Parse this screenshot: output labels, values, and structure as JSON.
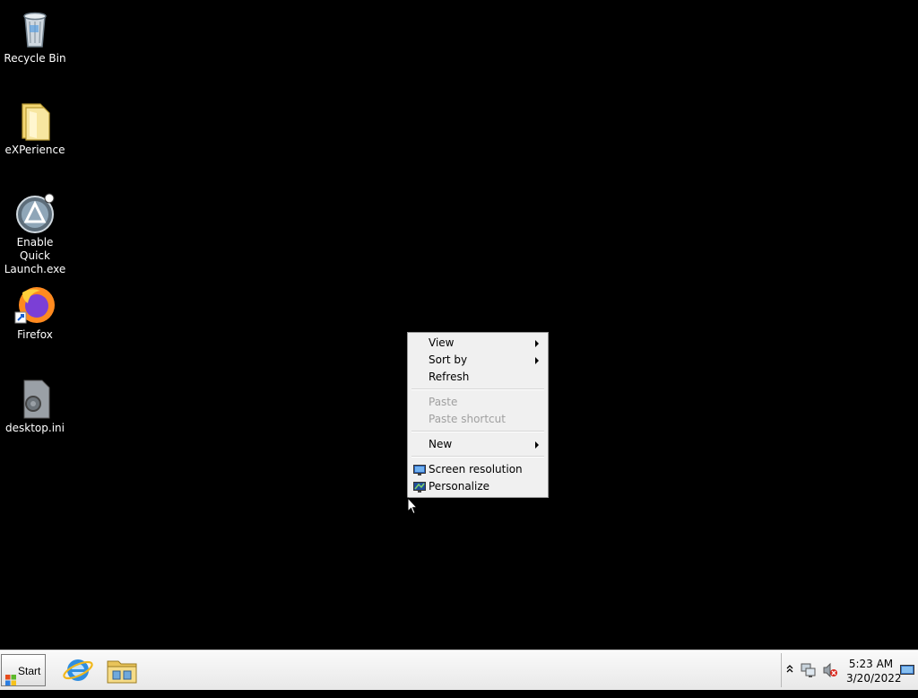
{
  "desktop": {
    "icons": [
      {
        "label": "Recycle Bin",
        "icon": "recycle-bin-icon"
      },
      {
        "label": "eXPerience",
        "icon": "folder-icon"
      },
      {
        "label": "Enable Quick Launch.exe",
        "icon": "app-exe-icon"
      },
      {
        "label": "Firefox",
        "icon": "firefox-icon"
      },
      {
        "label": "desktop.ini",
        "icon": "settings-file-icon"
      }
    ]
  },
  "context_menu": {
    "items": [
      {
        "label": "View",
        "enabled": true,
        "submenu": true
      },
      {
        "label": "Sort by",
        "enabled": true,
        "submenu": true
      },
      {
        "label": "Refresh",
        "enabled": true
      },
      {
        "label": "Paste",
        "enabled": false
      },
      {
        "label": "Paste shortcut",
        "enabled": false
      },
      {
        "label": "New",
        "enabled": true,
        "submenu": true
      },
      {
        "label": "Screen resolution",
        "enabled": true,
        "icon": "display-icon"
      },
      {
        "label": "Personalize",
        "enabled": true,
        "icon": "personalize-icon"
      }
    ]
  },
  "taskbar": {
    "start_label": "Start",
    "pinned": [
      {
        "icon": "internet-explorer-icon"
      },
      {
        "icon": "file-explorer-icon"
      }
    ],
    "clock": {
      "time": "5:23 AM",
      "date": "3/20/2022"
    }
  },
  "colors": {
    "desktop_bg": "#000000",
    "menu_bg": "#f0f0f0",
    "disabled_text": "#a0a0a0"
  }
}
